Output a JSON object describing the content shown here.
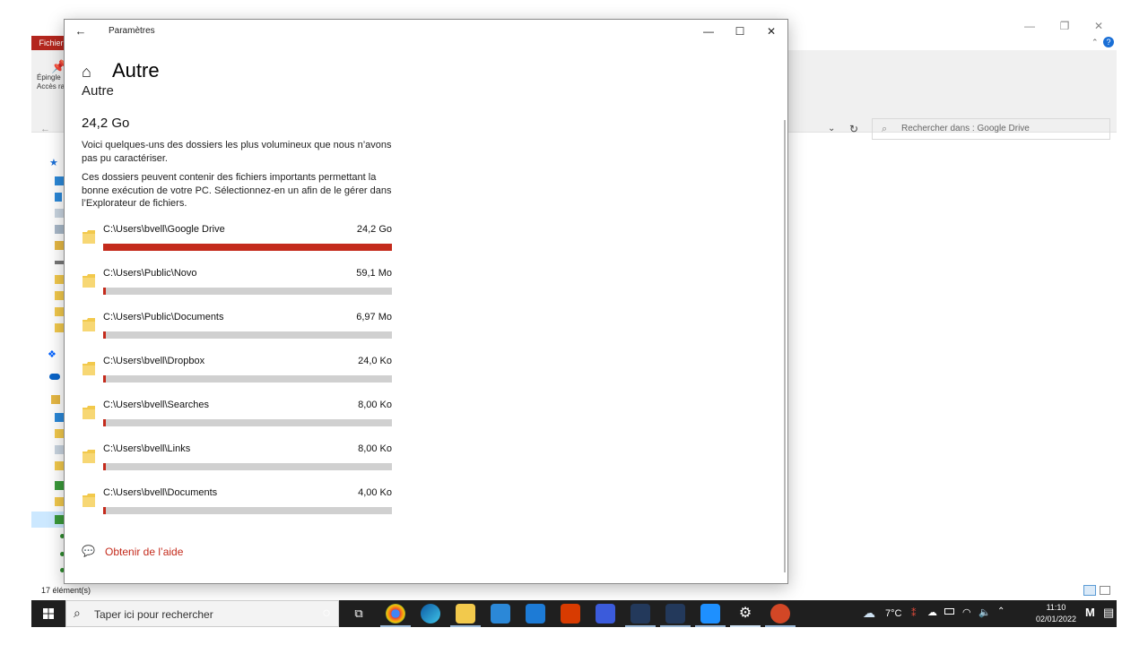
{
  "explorer": {
    "ribbon_tab": "Fichier",
    "pin_label_1": "Épingle",
    "pin_label_2": "Accès ra",
    "search_placeholder": "Rechercher dans : Google Drive",
    "status_text": "17 élément(s)"
  },
  "settings": {
    "window_title": "Paramètres",
    "back_icon": "back-arrow-icon",
    "page_heading": "Autre",
    "page_subheading": "Autre",
    "total_size": "24,2 Go",
    "description_1": "Voici quelques-uns des dossiers les plus volumineux que nous n’avons pas pu caractériser.",
    "description_2": "Ces dossiers peuvent contenir des fichiers importants permettant la bonne exécution de votre PC. Sélectionnez-en un afin de le gérer dans l’Explorateur de fichiers.",
    "help_link": "Obtenir de l’aide",
    "accent_color": "#c42b1c",
    "folders": [
      {
        "path": "C:\\Users\\bvell\\Google Drive",
        "size": "24,2 Go",
        "fill_fraction": 1.0
      },
      {
        "path": "C:\\Users\\Public\\Novo",
        "size": "59,1 Mo",
        "fill_fraction": 0.01
      },
      {
        "path": "C:\\Users\\Public\\Documents",
        "size": "6,97 Mo",
        "fill_fraction": 0.01
      },
      {
        "path": "C:\\Users\\bvell\\Dropbox",
        "size": "24,0 Ko",
        "fill_fraction": 0.01
      },
      {
        "path": "C:\\Users\\bvell\\Searches",
        "size": "8,00 Ko",
        "fill_fraction": 0.01
      },
      {
        "path": "C:\\Users\\bvell\\Links",
        "size": "8,00 Ko",
        "fill_fraction": 0.01
      },
      {
        "path": "C:\\Users\\bvell\\Documents",
        "size": "4,00 Ko",
        "fill_fraction": 0.01
      }
    ]
  },
  "taskbar": {
    "search_placeholder": "Taper ici pour rechercher",
    "temperature": "7°C",
    "time": "11:10",
    "date": "02/01/2022",
    "apps": [
      "cortana-icon",
      "task-view-icon",
      "chrome-icon",
      "edge-icon",
      "file-explorer-icon",
      "store-icon",
      "mail-icon",
      "office-icon",
      "app-icon",
      "app-icon",
      "app-icon",
      "photos-icon",
      "settings-icon",
      "powerpoint-icon"
    ]
  }
}
